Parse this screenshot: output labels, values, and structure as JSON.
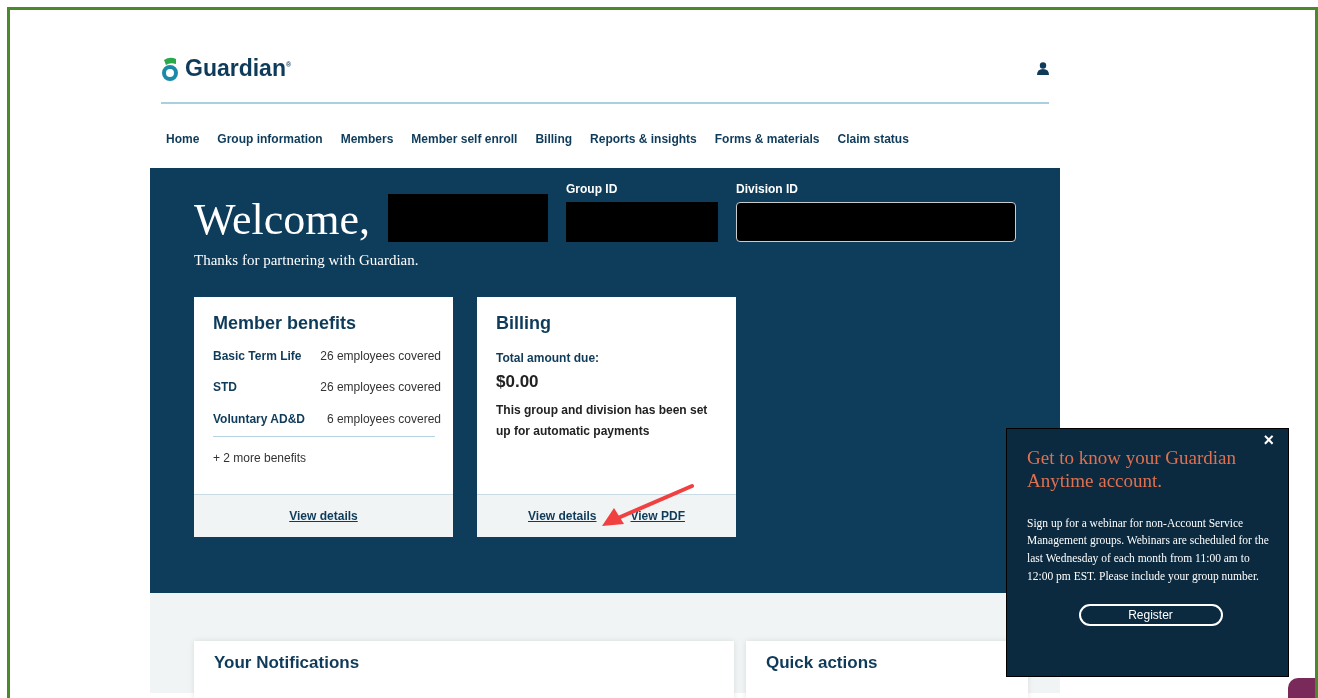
{
  "header": {
    "logo": "Guardian",
    "logo_mark": "®"
  },
  "nav": [
    "Home",
    "Group information",
    "Members",
    "Member self enroll",
    "Billing",
    "Reports & insights",
    "Forms & materials",
    "Claim status"
  ],
  "welcome": {
    "greeting": "Welcome,",
    "subtitle": "Thanks for partnering with Guardian.",
    "group_id_label": "Group ID",
    "division_id_label": "Division ID"
  },
  "member_benefits": {
    "title": "Member benefits",
    "rows": [
      {
        "name": "Basic Term Life",
        "coverage": "26 employees covered"
      },
      {
        "name": "STD",
        "coverage": "26 employees covered"
      },
      {
        "name": "Voluntary AD&D",
        "coverage": "6 employees covered"
      }
    ],
    "more": "+ 2 more benefits",
    "links": [
      "View details"
    ]
  },
  "billing": {
    "title": "Billing",
    "amount_label": "Total amount due:",
    "amount": "$0.00",
    "note": "This group and division has been set up for automatic payments",
    "links": [
      "View details",
      "View PDF"
    ]
  },
  "sections": [
    "Your Notifications",
    "Quick actions"
  ],
  "popup": {
    "close": "×",
    "title": "Get to know your Guardian Anytime account.",
    "body": "Sign up for a webinar for non-Account Service Management groups. Webinars are scheduled for the last Wednesday of each month from 11:00 am to 12:00 pm EST. Please include your group number.",
    "button": "Register"
  }
}
